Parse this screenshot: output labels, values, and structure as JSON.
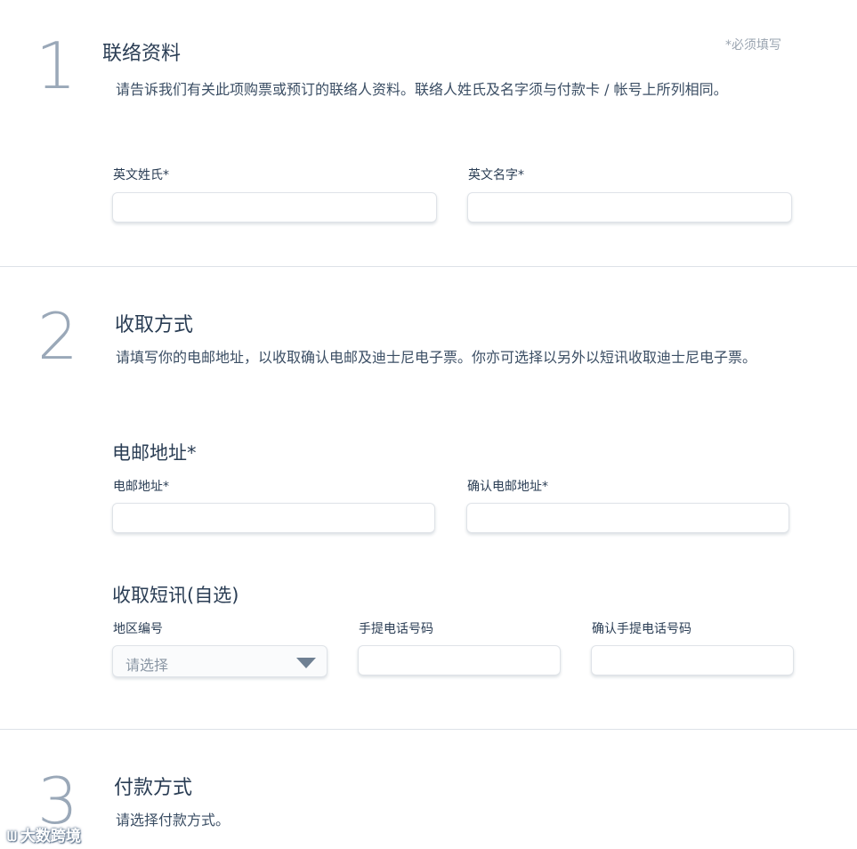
{
  "required_note": "*必须填写",
  "contact": {
    "number": "1",
    "title": "联络资料",
    "description": "请告诉我们有关此项购票或预订的联络人资料。联络人姓氏及名字须与付款卡 / 帐号上所列相同。",
    "last_name_label": "英文姓氏*",
    "last_name_value": "",
    "first_name_label": "英文名字*",
    "first_name_value": ""
  },
  "delivery": {
    "number": "2",
    "title": "收取方式",
    "description": "请填写你的电邮地址，以收取确认电邮及迪士尼电子票。你亦可选择以另外以短讯收取迪士尼电子票。",
    "email_heading": "电邮地址*",
    "email_label": "电邮地址*",
    "email_value": "",
    "confirm_email_label": "确认电邮地址*",
    "confirm_email_value": "",
    "sms_heading": "收取短讯(自选)",
    "region_label": "地区编号",
    "region_selected": "请选择",
    "mobile_label": "手提电话号码",
    "mobile_value": "",
    "confirm_mobile_label": "确认手提电话号码",
    "confirm_mobile_value": ""
  },
  "payment": {
    "number": "3",
    "title": "付款方式",
    "description": "请选择付款方式。"
  },
  "watermark": {
    "logo": "ᗯ",
    "text": "大数跨境"
  }
}
